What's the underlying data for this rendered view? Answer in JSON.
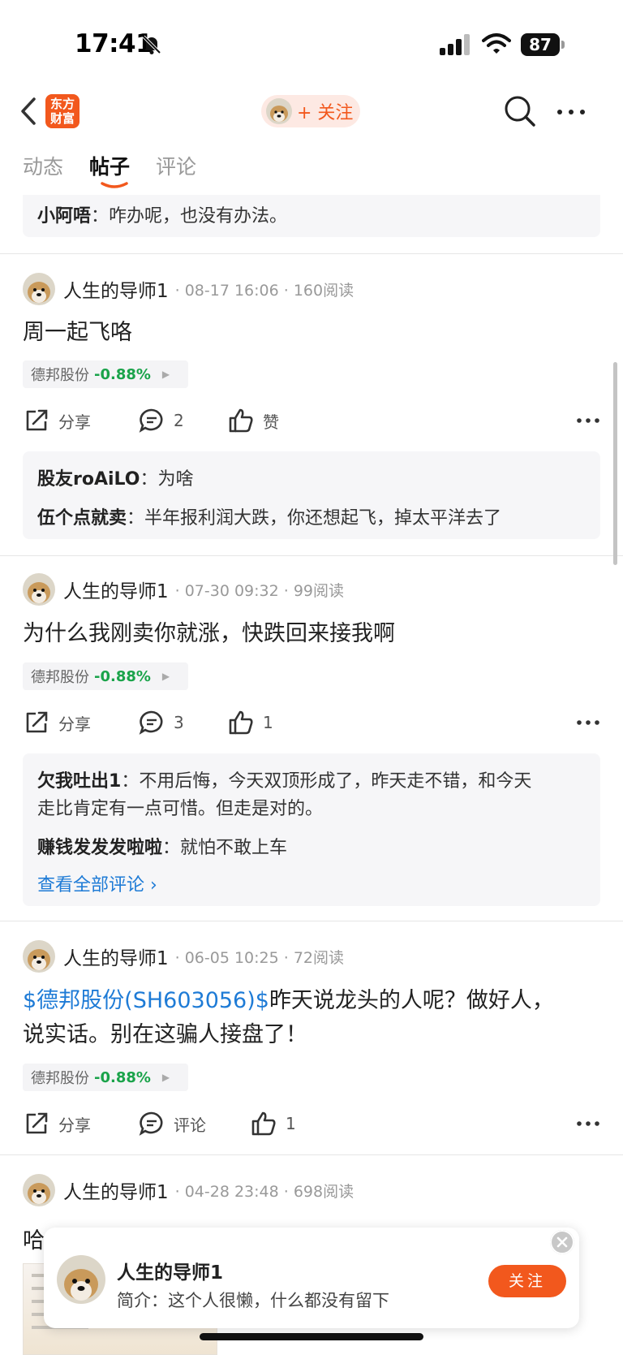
{
  "status": {
    "time": "17:41",
    "battery": "87"
  },
  "nav": {
    "logo": "东方\n财富",
    "follow_label": "+ 关注"
  },
  "tabs": [
    "动态",
    "帖子",
    "评论"
  ],
  "top_reply": {
    "user": "小阿唔",
    "text": "咋办呢，也没有办法。"
  },
  "posts": [
    {
      "author": "人生的导师1",
      "meta": "· 08-17 16:06 · 160阅读",
      "title": "周一起飞咯",
      "stock": "德邦股份",
      "change": "-0.88%",
      "share": "分享",
      "comments": "2",
      "likes": "赞",
      "replies": [
        {
          "user": "股友roAiLO",
          "text": "为啥"
        },
        {
          "user": "伍个点就卖",
          "text": "半年报利润大跌，你还想起飞，掉太平洋去了"
        }
      ]
    },
    {
      "author": "人生的导师1",
      "meta": "· 07-30 09:32 · 99阅读",
      "title": "为什么我刚卖你就涨，快跌回来接我啊",
      "stock": "德邦股份",
      "change": "-0.88%",
      "share": "分享",
      "comments": "3",
      "likes": "1",
      "replies": [
        {
          "user": "欠我吐出1",
          "text": "不用后悔，今天双顶形成了，昨天走不错，和今天",
          "text2": "走比肯定有一点可惜。但走是对的。"
        },
        {
          "user": "赚钱发发发啦啦",
          "text": "就怕不敢上车"
        }
      ],
      "view_all": "查看全部评论 ›"
    },
    {
      "author": "人生的导师1",
      "meta": "· 06-05 10:25 · 72阅读",
      "cashtag": "$德邦股份(SH603056)$",
      "title": "昨天说龙头的人呢？做好人，",
      "title2": "说实话。别在这骗人接盘了！",
      "stock": "德邦股份",
      "change": "-0.88%",
      "share": "分享",
      "comments": "评论",
      "likes": "1"
    },
    {
      "author": "人生的导师1",
      "meta": "· 04-28 23:48 · 698阅读",
      "title": "哈"
    }
  ],
  "profile_card": {
    "name": "人生的导师1",
    "bio": "简介：这个人很懒，什么都没有留下",
    "follow": "关注"
  },
  "colors": {
    "accent": "#f2581d",
    "down": "#1aa34a",
    "link": "#1e7bd6"
  }
}
